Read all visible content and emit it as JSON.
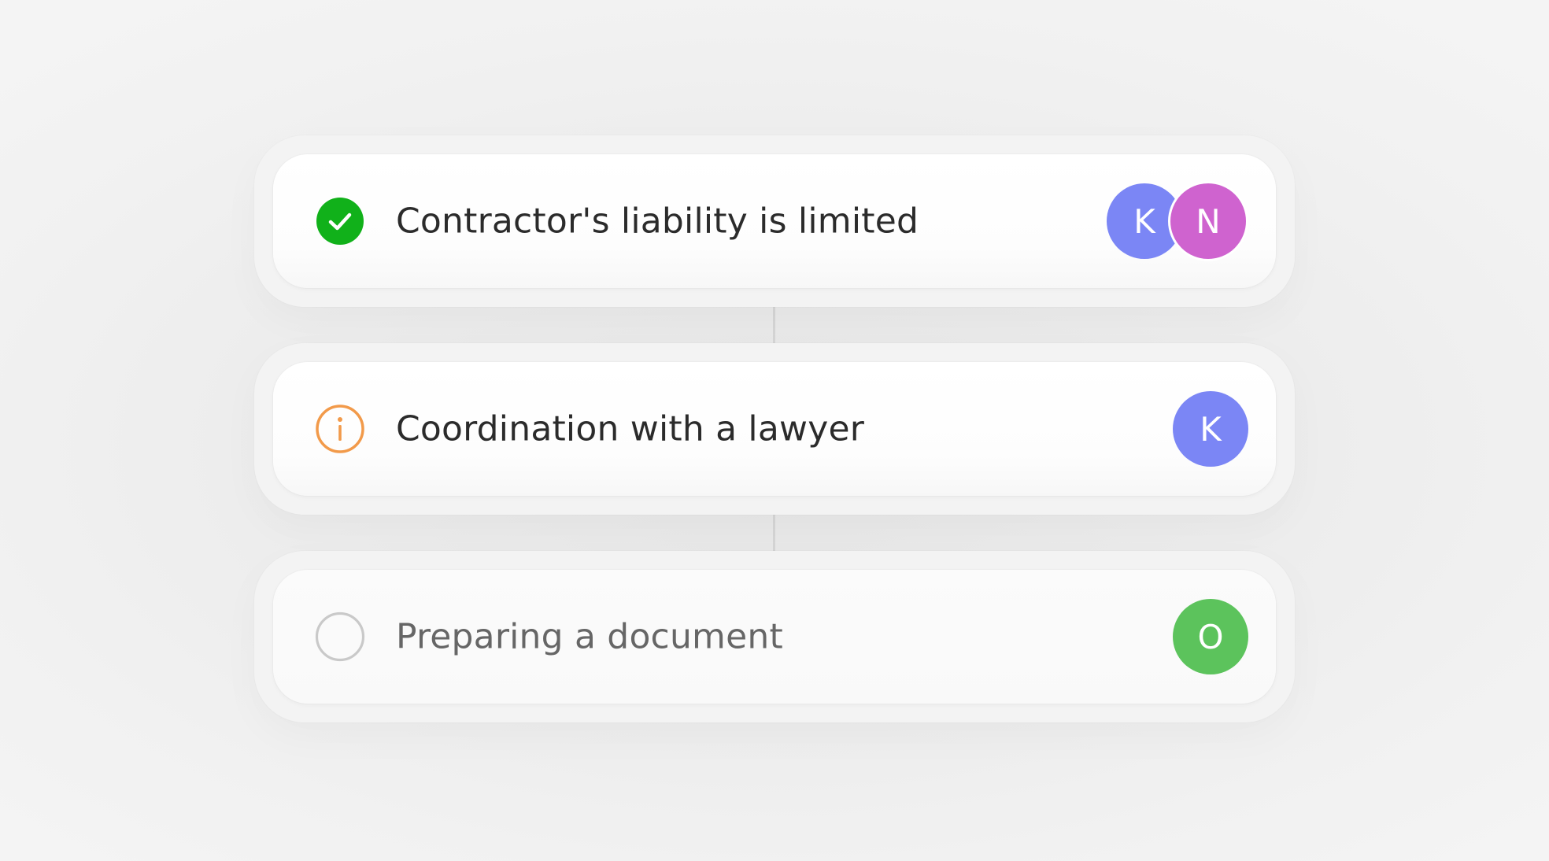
{
  "colors": {
    "done": "#11b11a",
    "pending": "#f29a4a",
    "todo": "#c9c9c9",
    "avatar_blue": "#7b86f5",
    "avatar_purple": "#cf63cf",
    "avatar_green": "#5cc35c"
  },
  "tasks": [
    {
      "title": "Contractor's liability is limited",
      "status": "done",
      "status_icon": "check-circle-icon",
      "assignees": [
        {
          "initial": "K",
          "color": "#7b86f5"
        },
        {
          "initial": "N",
          "color": "#cf63cf"
        }
      ]
    },
    {
      "title": "Coordination with a lawyer",
      "status": "pending",
      "status_icon": "info-circle-icon",
      "assignees": [
        {
          "initial": "K",
          "color": "#7b86f5"
        }
      ]
    },
    {
      "title": "Preparing a document",
      "status": "todo",
      "status_icon": "empty-circle-icon",
      "assignees": [
        {
          "initial": "O",
          "color": "#5cc35c"
        }
      ]
    }
  ]
}
